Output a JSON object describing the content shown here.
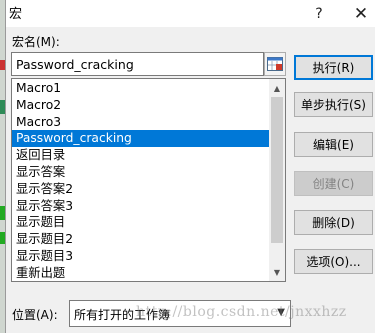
{
  "window": {
    "title": "宏",
    "help_glyph": "?",
    "close_glyph": "✕"
  },
  "macro_name": {
    "label": "宏名(M):",
    "value": "Password_cracking"
  },
  "macro_list": {
    "items": [
      "Macro1",
      "Macro2",
      "Macro3",
      "Password_cracking",
      "返回目录",
      "显示答案",
      "显示答案2",
      "显示答案3",
      "显示题目",
      "显示题目2",
      "显示题目3",
      "重新出题"
    ],
    "selected_index": 3
  },
  "buttons": {
    "run": "执行(R)",
    "step_into": "单步执行(S)",
    "edit": "编辑(E)",
    "create": "创建(C)",
    "delete": "删除(D)",
    "options": "选项(O)..."
  },
  "location": {
    "label": "位置(A):",
    "value": "所有打开的工作簿"
  },
  "watermark": "http://blog.csdn.net/jnxxhzz",
  "colors": {
    "selection": "#0078d7",
    "default_button_border": "#0078d7",
    "dialog_background": "#f0f0f0"
  }
}
